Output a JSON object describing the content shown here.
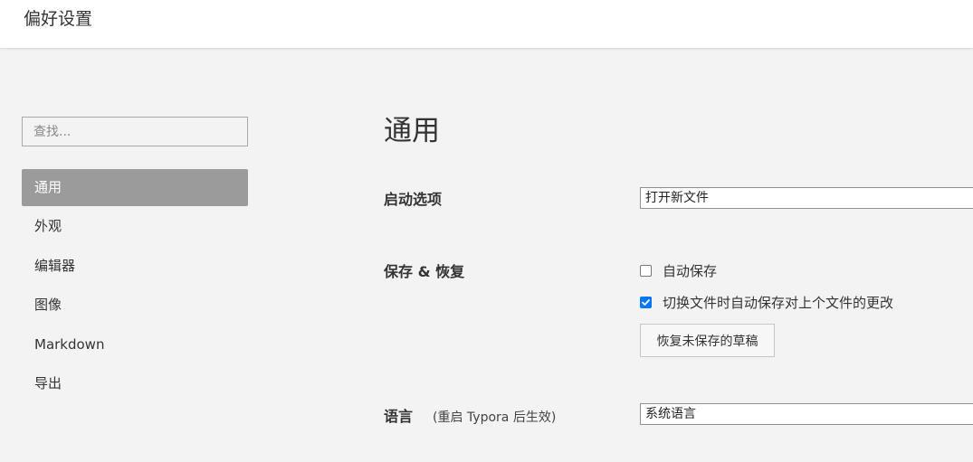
{
  "window": {
    "title": "偏好设置"
  },
  "sidebar": {
    "search_placeholder": "查找...",
    "items": [
      {
        "label": "通用",
        "active": true
      },
      {
        "label": "外观",
        "active": false
      },
      {
        "label": "编辑器",
        "active": false
      },
      {
        "label": "图像",
        "active": false
      },
      {
        "label": "Markdown",
        "active": false
      },
      {
        "label": "导出",
        "active": false
      }
    ]
  },
  "main": {
    "heading": "通用",
    "startup": {
      "label": "启动选项",
      "value": "打开新文件"
    },
    "save_restore": {
      "label": "保存 & 恢复",
      "autosave": {
        "label": "自动保存",
        "checked": false
      },
      "autosave_on_switch": {
        "label": "切换文件时自动保存对上个文件的更改",
        "checked": true
      },
      "restore_button": "恢复未保存的草稿"
    },
    "language": {
      "label": "语言",
      "hint": "(重启 Typora 后生效)",
      "value": "系统语言"
    }
  },
  "colors": {
    "active_item_bg": "#9b9b9b",
    "checkbox_accent": "#0075ff",
    "page_bg": "#f3f3f3",
    "titlebar_bg": "#ffffff"
  }
}
